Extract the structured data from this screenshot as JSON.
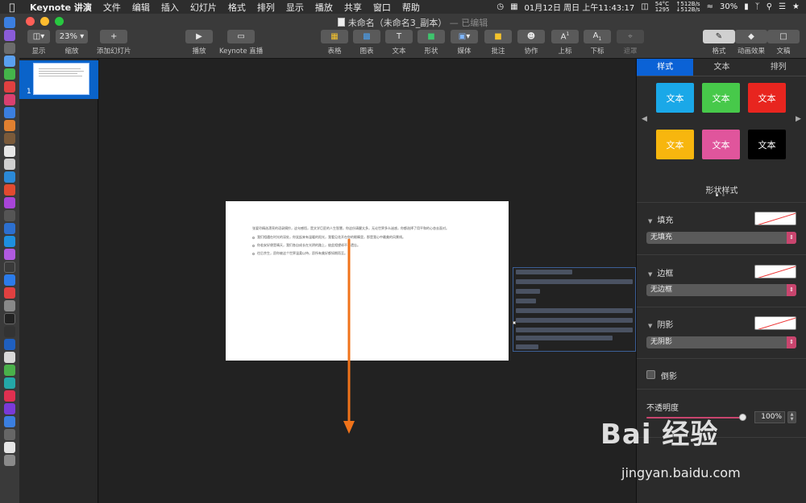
{
  "menubar": {
    "app": "Keynote 讲演",
    "items": [
      "文件",
      "编辑",
      "插入",
      "幻灯片",
      "格式",
      "排列",
      "显示",
      "播放",
      "共享",
      "窗口",
      "帮助"
    ],
    "datetime": "01月12日 周日 上午11:43:17",
    "temp": "54°C",
    "fan": "1295",
    "net_up": "↑512B/s",
    "net_down": "↓512B/s",
    "battery": "30%"
  },
  "window": {
    "title": "未命名（未命名3_副本）",
    "edited": "— 已编辑"
  },
  "toolbar": {
    "view": "显示",
    "zoom_value": "23%",
    "zoom": "缩放",
    "add_slide": "添加幻灯片",
    "play": "播放",
    "keynote_live": "Keynote 直播",
    "table": "表格",
    "chart": "图表",
    "text": "文本",
    "shape": "形状",
    "media": "媒体",
    "comment": "批注",
    "collaborate": "协作",
    "superscript": "上标",
    "subscript": "下标",
    "mask": "遮罩",
    "format": "格式",
    "animate": "动画效果",
    "document": "文稿"
  },
  "navigator": {
    "slide_number": "1"
  },
  "slide": {
    "intro": "张爱玲精选漂亮的语录摘抄，这句感悟，是文学巨匠的人生智慧，你这份清醒太多，无论世界多么迷惑，你都选择了用平和的心态去面对。",
    "bullets": [
      "我们相遇在时光的深处，你笑起来有温暖的阳光，我看见花开在你的眼睛里，那是我心中最美的风景线。",
      "你若安好便是晴天，我们各自成长在光阴的路上，彼此相望却不曾遗忘。",
      "往后余生，愿你被这个世界温柔以待，愿所有美好都如期而至。"
    ]
  },
  "inspector": {
    "tabs": [
      "样式",
      "文本",
      "排列"
    ],
    "swatch_label": "文本",
    "swatch_colors": [
      "#1aa8e8",
      "#47c94a",
      "#e8251f",
      "#f7b60e",
      "#e0559c",
      "#000000"
    ],
    "shape_style": "形状样式",
    "fill": "填充",
    "fill_value": "无填充",
    "border": "边框",
    "border_value": "无边框",
    "shadow": "阴影",
    "shadow_value": "无阴影",
    "reflection": "倒影",
    "opacity": "不透明度",
    "opacity_value": "100%",
    "opacity_level": 1.0
  },
  "watermark": {
    "brand": "Bai 经验",
    "url": "jingyan.baidu.com"
  },
  "colors": {
    "accent_blue": "#0b62d6",
    "popup_pink": "#c9456e",
    "arrow_orange": "#f0731a"
  }
}
